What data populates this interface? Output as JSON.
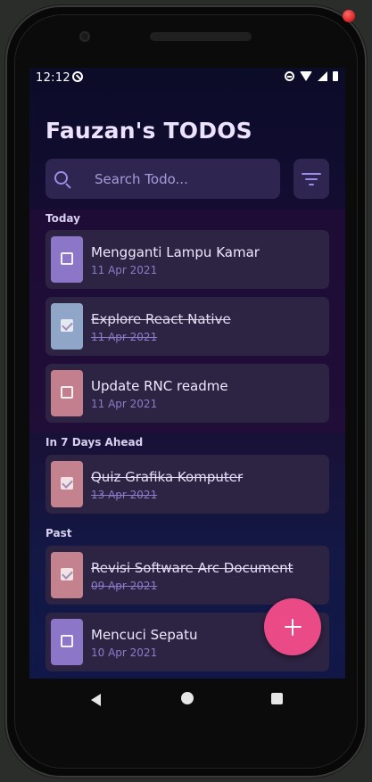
{
  "status_bar": {
    "time": "12:12"
  },
  "app": {
    "title": "Fauzan's TODOS"
  },
  "search": {
    "placeholder": "Search Todo..."
  },
  "sections": [
    {
      "label": "Today",
      "items": [
        {
          "title": "Mengganti Lampu Kamar",
          "date": "11 Apr 2021",
          "done": false,
          "color": "#8b76c8"
        },
        {
          "title": "Explore React Native",
          "date": "11 Apr 2021",
          "done": true,
          "color": "#8fa6c9"
        },
        {
          "title": "Update RNC readme",
          "date": "11 Apr 2021",
          "done": false,
          "color": "#c47f8f"
        }
      ]
    },
    {
      "label": "In 7 Days Ahead",
      "items": [
        {
          "title": "Quiz Grafika Komputer",
          "date": "13 Apr 2021",
          "done": true,
          "color": "#c4828f"
        }
      ]
    },
    {
      "label": "Past",
      "items": [
        {
          "title": "Revisi Software Arc Document",
          "date": "09 Apr 2021",
          "done": true,
          "color": "#c4828f"
        },
        {
          "title": "Mencuci Sepatu",
          "date": "10 Apr 2021",
          "done": false,
          "color": "#8b76c8"
        }
      ]
    }
  ],
  "colors": {
    "accent": "#ea4a86",
    "card": "#2d2342",
    "title": "#eee3ff"
  },
  "icons": {
    "search": "search-icon",
    "filter": "filter-icon",
    "add": "plus-icon",
    "nav": [
      "back-icon",
      "home-icon",
      "recents-icon"
    ]
  }
}
